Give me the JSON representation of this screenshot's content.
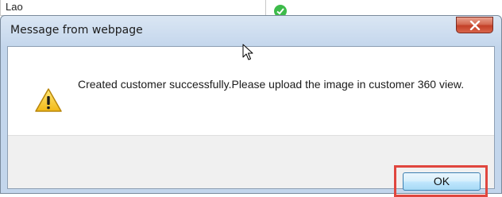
{
  "background": {
    "input_value": "Lao"
  },
  "dialog": {
    "title": "Message from webpage",
    "close_label": "x",
    "message": "Created customer successfully.Please upload the image in customer 360 view.",
    "ok_label": "OK",
    "icon": "warning-icon"
  },
  "colors": {
    "title_bar": "#c9daee",
    "close_button": "#c43f27",
    "highlight": "#e0463e",
    "ok_button": "#bee6fd"
  }
}
